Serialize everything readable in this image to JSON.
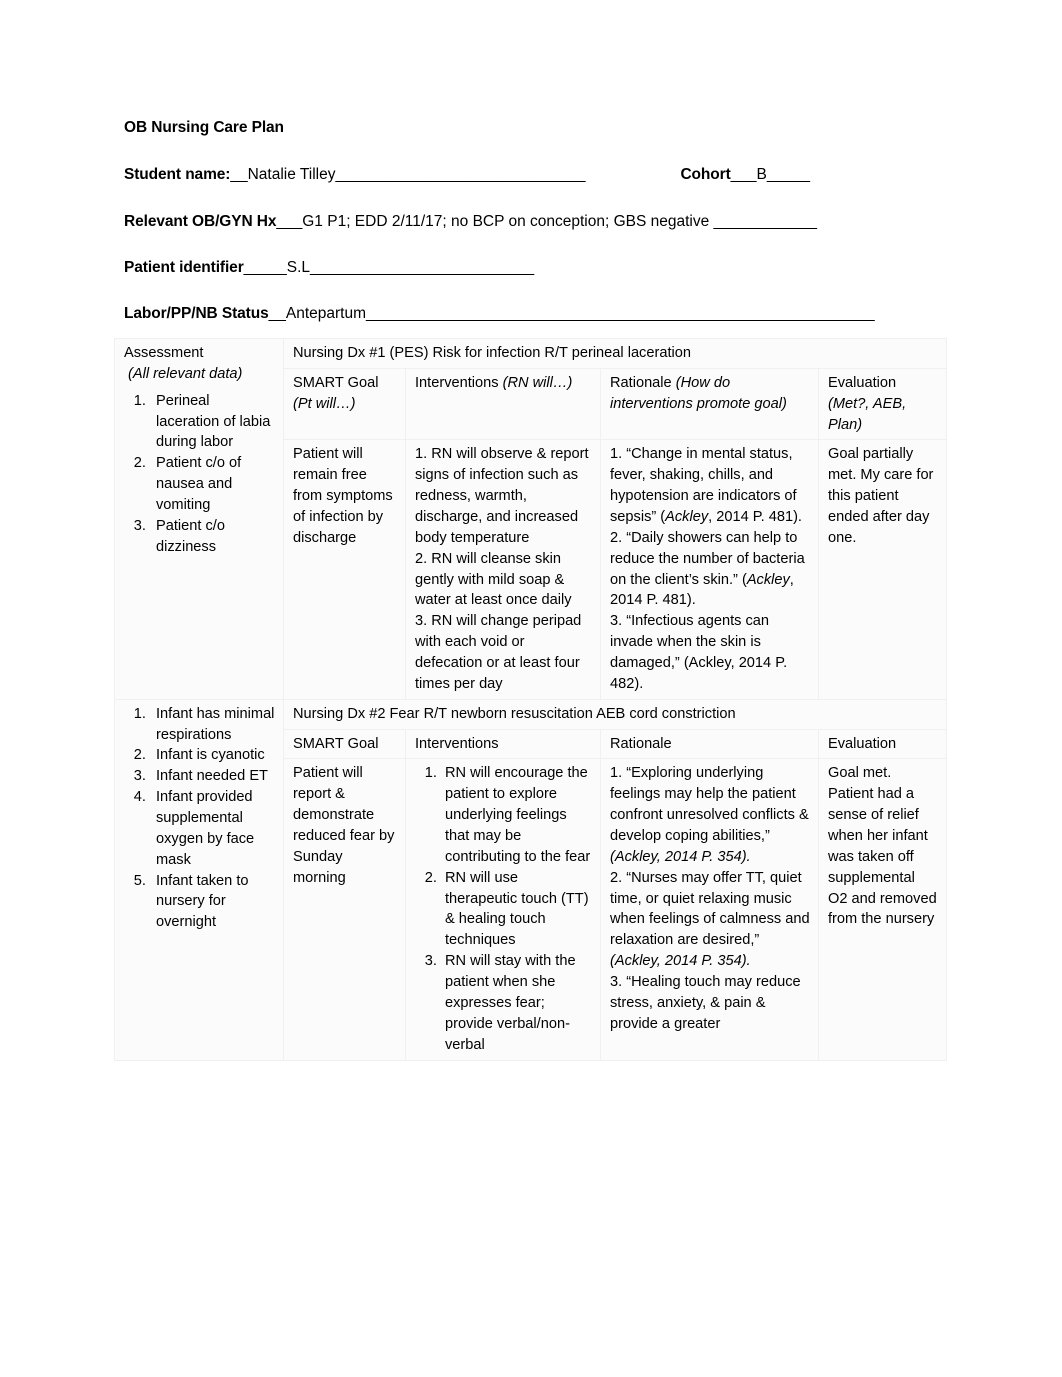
{
  "document": {
    "title": "OB Nursing Care Plan",
    "fields": [
      {
        "label": "Student name:",
        "value": "__Natalie Tilley_____________________________"
      },
      {
        "label": "Cohort",
        "value": "___B_____"
      },
      {
        "label": "Relevant OB/GYN Hx",
        "value": "___G1 P1; EDD 2/11/17; no BCP on conception; GBS negative ____________"
      },
      {
        "label": "Patient identifier",
        "value": "_____S.L__________________________"
      },
      {
        "label": "Labor/PP/NB Status",
        "value": "__Antepartum___________________________________________________________"
      }
    ]
  },
  "table": {
    "assessment_header": "Assessment",
    "assessment_subheader": "(All relevant data)",
    "columns": {
      "smart_goal": "SMART Goal",
      "smart_goal_hint": "(Pt will…)",
      "interventions": "Interventions",
      "interventions_hint": "(RN will…)",
      "rationale": "Rationale",
      "rationale_hint": "(How do interventions promote goal)",
      "evaluation": "Evaluation",
      "evaluation_hint": "(Met?, AEB, Plan)"
    },
    "rows": [
      {
        "dx_heading": "Nursing Dx #1 (PES) Risk for infection R/T perineal laceration",
        "assessment": [
          "Perineal laceration of labia during labor",
          "Patient c/o of nausea and vomiting",
          "Patient c/o dizziness"
        ],
        "smart_goal": "Patient will remain free from symptoms of infection by discharge",
        "interventions": [
          "1.  RN will observe & report signs of infection such as redness, warmth, discharge, and increased body temperature",
          "2. RN will cleanse skin gently with mild soap & water at least once daily",
          "3. RN will change peripad with each void or defecation or at least four times per day"
        ],
        "rationale": [
          {
            "text": "1. “Change in mental status, fever, shaking, chills, and hypotension are indicators of sepsis” (",
            "cite_italic": "Ackley",
            "tail": ", 2014 P. 481)."
          },
          {
            "text": "2. “Daily showers can help to reduce the number of bacteria on the client’s skin.” (",
            "cite_italic": "Ackley",
            "tail": ", 2014 P. 481)."
          },
          {
            "text": "3. “Infectious agents can invade when the skin is damaged,” (Ackley, 2014 P. 482).",
            "cite_italic": "",
            "tail": ""
          }
        ],
        "evaluation": "Goal partially met.  My care for this patient ended after day one."
      },
      {
        "dx_heading": "Nursing Dx #2 Fear R/T newborn resuscitation AEB cord constriction",
        "assessment": [
          "Infant has minimal respirations",
          "Infant is cyanotic",
          "Infant needed ET",
          "Infant provided supplemental oxygen by face mask",
          "Infant taken to nursery for overnight"
        ],
        "smart_goal": "Patient will report & demonstrate reduced fear by Sunday morning",
        "interventions": [
          "RN will encourage the patient to explore underlying feelings that may be contributing to the fear",
          "RN will use therapeutic touch (TT) & healing touch techniques",
          "RN will stay with the patient when she expresses fear; provide verbal/non-verbal"
        ],
        "rationale": [
          {
            "text": "1. “Exploring underlying feelings may help the patient confront unresolved conflicts & develop coping abilities,” ",
            "cite_italic": "(Ackley, 2014 P. 354).",
            "tail": ""
          },
          {
            "text": "2. “Nurses may offer TT, quiet time, or quiet relaxing music when feelings of calmness and relaxation are desired,” ",
            "cite_italic": "(Ackley, 2014 P. 354).",
            "tail": ""
          },
          {
            "text": "3. “Healing touch may reduce stress, anxiety, & pain & provide a greater",
            "cite_italic": "",
            "tail": ""
          }
        ],
        "evaluation": "Goal met. Patient had a sense of relief when her infant was taken off supplemental O2 and removed from the nursery"
      }
    ]
  }
}
